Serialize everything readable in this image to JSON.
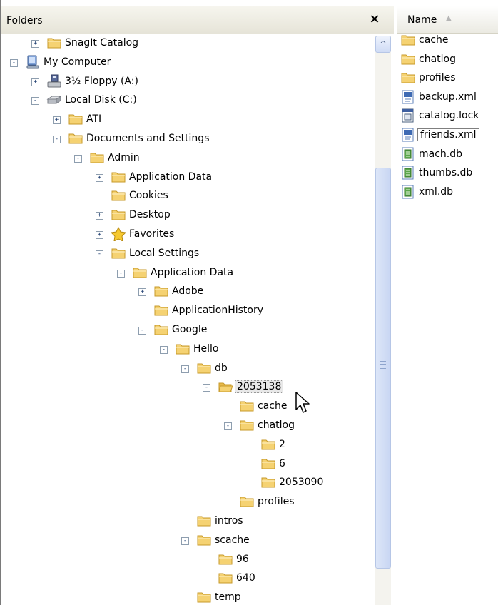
{
  "folders_pane": {
    "title": "Folders",
    "close_glyph": "×",
    "scroll_up_glyph": "^"
  },
  "tree": [
    {
      "label": "SnagIt Catalog",
      "icon": "folder-icon",
      "expander": "+",
      "depth": 1
    },
    {
      "label": "My Computer",
      "icon": "computer-icon",
      "expander": "-",
      "depth": 0
    },
    {
      "label": "3½ Floppy (A:)",
      "icon": "floppy-drive-icon",
      "expander": "+",
      "depth": 1
    },
    {
      "label": "Local Disk (C:)",
      "icon": "hard-disk-icon",
      "expander": "-",
      "depth": 1
    },
    {
      "label": "ATI",
      "icon": "folder-icon",
      "expander": "+",
      "depth": 2
    },
    {
      "label": "Documents and Settings",
      "icon": "folder-icon",
      "expander": "-",
      "depth": 2
    },
    {
      "label": "Admin",
      "icon": "folder-icon",
      "expander": "-",
      "depth": 3
    },
    {
      "label": "Application Data",
      "icon": "folder-icon",
      "expander": "+",
      "depth": 4
    },
    {
      "label": "Cookies",
      "icon": "folder-icon",
      "expander": "",
      "depth": 4
    },
    {
      "label": "Desktop",
      "icon": "folder-icon",
      "expander": "+",
      "depth": 4
    },
    {
      "label": "Favorites",
      "icon": "star-icon",
      "expander": "+",
      "depth": 4
    },
    {
      "label": "Local Settings",
      "icon": "folder-icon",
      "expander": "-",
      "depth": 4
    },
    {
      "label": "Application Data",
      "icon": "folder-icon",
      "expander": "-",
      "depth": 5
    },
    {
      "label": "Adobe",
      "icon": "folder-icon",
      "expander": "+",
      "depth": 6
    },
    {
      "label": "ApplicationHistory",
      "icon": "folder-icon",
      "expander": "",
      "depth": 6
    },
    {
      "label": "Google",
      "icon": "folder-icon",
      "expander": "-",
      "depth": 6
    },
    {
      "label": "Hello",
      "icon": "folder-icon",
      "expander": "-",
      "depth": 7
    },
    {
      "label": "db",
      "icon": "folder-icon",
      "expander": "-",
      "depth": 8
    },
    {
      "label": "2053138",
      "icon": "folder-open-icon",
      "expander": "-",
      "depth": 9,
      "selected": true
    },
    {
      "label": "cache",
      "icon": "folder-icon",
      "expander": "",
      "depth": 10
    },
    {
      "label": "chatlog",
      "icon": "folder-icon",
      "expander": "-",
      "depth": 10
    },
    {
      "label": "2",
      "icon": "folder-icon",
      "expander": "",
      "depth": 11
    },
    {
      "label": "6",
      "icon": "folder-icon",
      "expander": "",
      "depth": 11
    },
    {
      "label": "2053090",
      "icon": "folder-icon",
      "expander": "",
      "depth": 11
    },
    {
      "label": "profiles",
      "icon": "folder-icon",
      "expander": "",
      "depth": 10
    },
    {
      "label": "intros",
      "icon": "folder-icon",
      "expander": "",
      "depth": 8
    },
    {
      "label": "scache",
      "icon": "folder-icon",
      "expander": "-",
      "depth": 8
    },
    {
      "label": "96",
      "icon": "folder-icon",
      "expander": "",
      "depth": 9
    },
    {
      "label": "640",
      "icon": "folder-icon",
      "expander": "",
      "depth": 9
    },
    {
      "label": "temp",
      "icon": "folder-icon",
      "expander": "",
      "depth": 8
    }
  ],
  "files_pane": {
    "column_header": "Name",
    "sort_indicator": "▲",
    "items": [
      {
        "name": "cache",
        "icon": "folder-icon"
      },
      {
        "name": "chatlog",
        "icon": "folder-icon"
      },
      {
        "name": "profiles",
        "icon": "folder-icon"
      },
      {
        "name": "backup.xml",
        "icon": "xml-file-icon"
      },
      {
        "name": "catalog.lock",
        "icon": "lock-file-icon"
      },
      {
        "name": "friends.xml",
        "icon": "xml-file-icon",
        "focused": true
      },
      {
        "name": "mach.db",
        "icon": "db-file-icon"
      },
      {
        "name": "thumbs.db",
        "icon": "db-file-icon"
      },
      {
        "name": "xml.db",
        "icon": "db-file-icon"
      }
    ]
  },
  "colors": {
    "folder_fill": "#f5d272",
    "folder_stroke": "#c79a2a",
    "scrollbar_thumb": "#c8d6f3",
    "header_bg": "#ece9d8"
  }
}
